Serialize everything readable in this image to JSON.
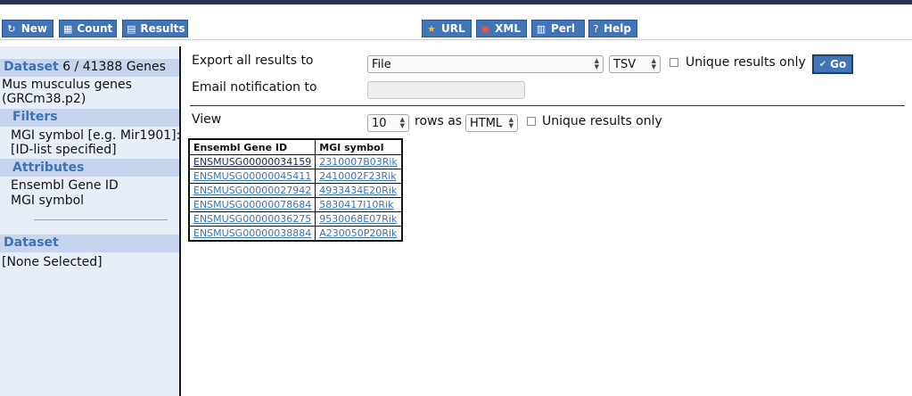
{
  "toolbar": {
    "new_label": "New",
    "count_label": "Count",
    "results_label": "Results",
    "url_label": "URL",
    "xml_label": "XML",
    "perl_label": "Perl",
    "help_label": "Help"
  },
  "sidebar": {
    "dataset_heading": "Dataset",
    "dataset_count": "6 / 41388 Genes",
    "dataset_name_line1": "Mus musculus genes",
    "dataset_name_line2": "(GRCm38.p2)",
    "filters_heading": "Filters",
    "filter_line1": "MGI symbol [e.g. Mir1901]:",
    "filter_line2": "[ID-list specified]",
    "attributes_heading": "Attributes",
    "attributes": [
      "Ensembl Gene ID",
      "MGI symbol"
    ],
    "dataset2_heading": "Dataset",
    "dataset2_value": "[None Selected]"
  },
  "export": {
    "label": "Export  all results to",
    "destination": "File",
    "format": "TSV",
    "unique_label": "Unique results only",
    "go_label": "Go",
    "email_label": "Email notification to",
    "email_value": ""
  },
  "view": {
    "label": "View",
    "rows": "10",
    "rows_as_label": "rows as",
    "format": "HTML",
    "unique_label": "Unique results only"
  },
  "results": {
    "headers": [
      "Ensembl Gene ID",
      "MGI symbol"
    ],
    "rows": [
      [
        "ENSMUSG00000034159",
        "2310007B03Rik"
      ],
      [
        "ENSMUSG00000045411",
        "2410002F23Rik"
      ],
      [
        "ENSMUSG00000027942",
        "4933434E20Rik"
      ],
      [
        "ENSMUSG00000078684",
        "5830417I10Rik"
      ],
      [
        "ENSMUSG00000036275",
        "9530068E07Rik"
      ],
      [
        "ENSMUSG00000038884",
        "A230050P20Rik"
      ]
    ]
  },
  "colors": {
    "button_blue": "#4275b6",
    "sidebar_bg": "#e8eef8",
    "sidebar_heading_bg": "#c6d5ec",
    "heading_text": "#3d73b9",
    "topbar": "#2e2f55"
  },
  "icons": {
    "new": "refresh-icon",
    "count": "calculator-icon",
    "results": "table-icon",
    "url": "star-icon",
    "xml": "xml-file-icon",
    "perl": "script-icon",
    "help": "help-icon",
    "go": "check-circle-icon"
  }
}
